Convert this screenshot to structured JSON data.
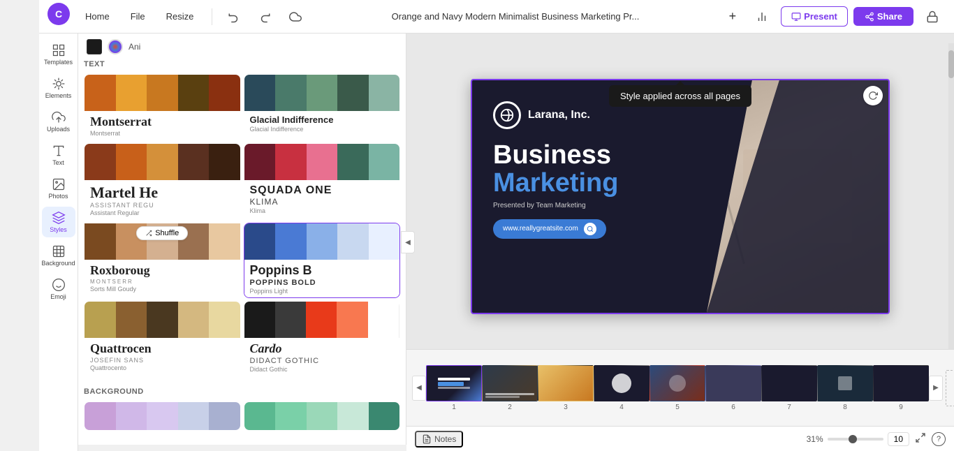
{
  "app": {
    "logo_letter": "C",
    "title": "Orange and Navy Modern Minimalist Business Marketing Pr...",
    "tooltip_text": "Style applied across all pages"
  },
  "topbar": {
    "nav_items": [
      "Home",
      "File",
      "Resize"
    ],
    "actions": {
      "present_label": "Present",
      "share_label": "Share"
    }
  },
  "sidebar": {
    "items": [
      {
        "id": "templates",
        "label": "Templates",
        "icon": "grid-icon"
      },
      {
        "id": "elements",
        "label": "Elements",
        "icon": "elements-icon"
      },
      {
        "id": "uploads",
        "label": "Uploads",
        "icon": "upload-icon"
      },
      {
        "id": "text",
        "label": "Text",
        "icon": "text-icon"
      },
      {
        "id": "photos",
        "label": "Photos",
        "icon": "photos-icon"
      },
      {
        "id": "styles",
        "label": "Styles",
        "icon": "styles-icon"
      },
      {
        "id": "background",
        "label": "Background",
        "icon": "background-icon"
      },
      {
        "id": "emoji",
        "label": "Emoji",
        "icon": "emoji-icon"
      }
    ]
  },
  "panel": {
    "color_bar": {
      "swatch1": "#1a1a1a",
      "swatch2_icon": "color-dot"
    },
    "sections": [
      {
        "id": "text-section",
        "label": "Text",
        "cards": [
          {
            "id": "montserrat-card",
            "colors": [
              "#c8621a",
              "#e8a030",
              "#c87820",
              "#5a4010",
              "#8a3010"
            ],
            "font_large": "Montserrat",
            "font_small": "",
            "font_tiny": "Montserrat"
          },
          {
            "id": "glacial-card",
            "colors": [
              "#2a4a5a",
              "#4a7a6a",
              "#6a9a7a",
              "#3a5a4a",
              "#8ab4a4"
            ],
            "font_large": "Glacial Indifference",
            "font_small": "",
            "font_tiny": "Glacial Indifference"
          },
          {
            "id": "martel-card",
            "colors": [
              "#8a3a1a",
              "#c8601a",
              "#d4903a",
              "#5a3020",
              "#3a2010"
            ],
            "font_large": "Martel He",
            "font_small": "ASSISTANT REGU",
            "font_tiny": "Assistant Regular"
          },
          {
            "id": "squada-card",
            "colors": [
              "#6a1a2a",
              "#c83040",
              "#e87090",
              "#3a6a5a",
              "#7ab4a4"
            ],
            "font_large": "SQUADA ONE",
            "font_small": "Klima",
            "font_tiny": "Klima"
          },
          {
            "id": "roxborough-card",
            "colors": [
              "#7a4a20",
              "#c89060",
              "#d4b090",
              "#9a7050",
              "#e8c8a0"
            ],
            "font_large": "Roxboroug",
            "font_small": "MONTSERR",
            "font_tiny": "Sorts Mill Goudy",
            "has_shuffle": true
          },
          {
            "id": "poppins-card",
            "colors": [
              "#2a4a8a",
              "#4a7ad4",
              "#8ab0e8",
              "#c8d8f0",
              "#e8f0ff"
            ],
            "font_large": "Poppins B",
            "font_small": "Poppins Bold",
            "font_tiny": "Poppins Light",
            "has_shuffle": false,
            "is_highlighted": true
          },
          {
            "id": "quattrocento-card",
            "colors": [
              "#b8a050",
              "#8a6030",
              "#4a3820",
              "#d4b880",
              "#e8d8a0"
            ],
            "font_large": "Quattrocen",
            "font_small": "JOSEFIN SANS",
            "font_tiny": "Quattrocento"
          },
          {
            "id": "cardo-card",
            "colors": [
              "#1a1a1a",
              "#3a3a3a",
              "#e83a1a",
              "#f87850",
              "#ffffff"
            ],
            "font_large": "Cardo",
            "font_small": "Didact Gothic",
            "font_tiny": "Didact Gothic"
          }
        ]
      },
      {
        "id": "background-section",
        "label": "Background",
        "cards": [
          {
            "id": "bg-card-1",
            "colors": [
              "#c8a0d8",
              "#d0b8e8",
              "#d8c8f0",
              "#c8d0e8",
              "#a8b0d0"
            ]
          },
          {
            "id": "bg-card-2",
            "colors": [
              "#5ab890",
              "#7ad0a8",
              "#9ad8b8",
              "#c8e8d8",
              "#3a8870"
            ]
          }
        ]
      }
    ]
  },
  "slide": {
    "company_name": "Larana, Inc.",
    "title_line1": "Business",
    "title_line2": "Marketing",
    "subtitle": "Presented by Team Marketing",
    "url": "www.reallygreatsite.com"
  },
  "thumbnails": [
    {
      "num": "1",
      "active": true,
      "bg_class": "thumb-1"
    },
    {
      "num": "2",
      "active": false,
      "bg_class": "thumb-2"
    },
    {
      "num": "3",
      "active": false,
      "bg_class": "thumb-3"
    },
    {
      "num": "4",
      "active": false,
      "bg_class": "thumb-4"
    },
    {
      "num": "5",
      "active": false,
      "bg_class": "thumb-5"
    },
    {
      "num": "6",
      "active": false,
      "bg_class": "thumb-6"
    },
    {
      "num": "7",
      "active": false,
      "bg_class": "thumb-7"
    },
    {
      "num": "8",
      "active": false,
      "bg_class": "thumb-8"
    },
    {
      "num": "9",
      "active": false,
      "bg_class": "thumb-9"
    }
  ],
  "bottom_bar": {
    "notes_label": "Notes",
    "zoom_percent": "31%",
    "page_count": "10"
  },
  "colors": {
    "accent": "#7c3aed",
    "nav_active_bg": "#e8f0fe"
  }
}
